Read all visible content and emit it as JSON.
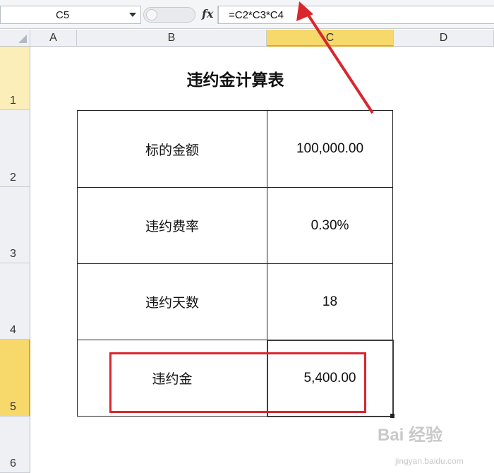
{
  "formula_bar": {
    "name_box": "C5",
    "fx_label": "fx",
    "formula": "=C2*C3*C4"
  },
  "columns": [
    "A",
    "B",
    "C",
    "D"
  ],
  "rows": [
    "1",
    "2",
    "3",
    "4",
    "5",
    "6"
  ],
  "sheet": {
    "title": "违约金计算表",
    "table": [
      {
        "label": "标的金额",
        "value": "100,000.00"
      },
      {
        "label": "违约费率",
        "value": "0.30%"
      },
      {
        "label": "违约天数",
        "value": "18"
      },
      {
        "label": "违约金",
        "value": "5,400.00"
      }
    ]
  },
  "annotation_color": "#d9262e",
  "watermark": {
    "brand": "Bai 经验",
    "site": "jingyan.baidu.com"
  }
}
